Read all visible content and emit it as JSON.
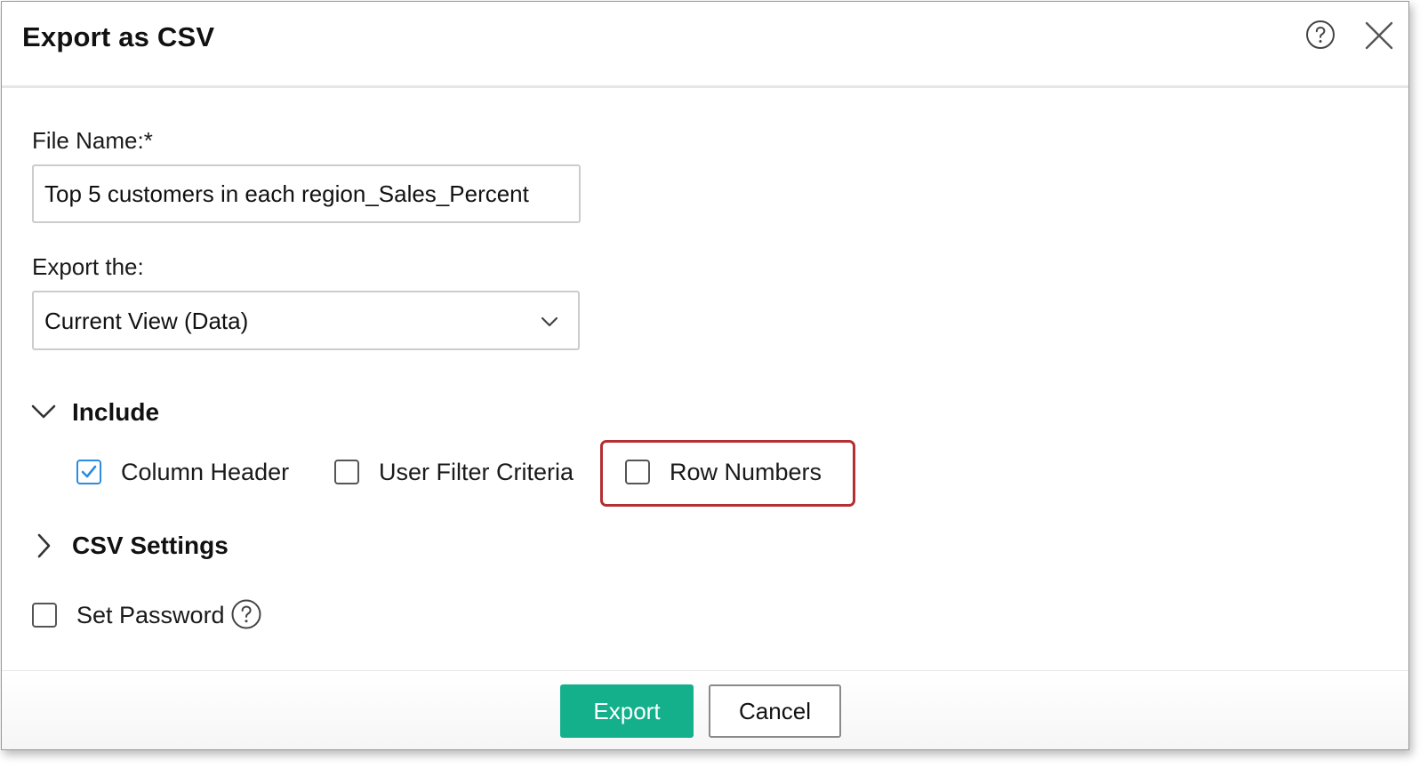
{
  "dialog": {
    "title": "Export as CSV"
  },
  "icons": {
    "help": "help-icon",
    "close": "close-icon",
    "chevron_down": "chevron-down-icon",
    "chevron_right": "chevron-right-icon",
    "checkmark": "checkmark-icon"
  },
  "form": {
    "file_name_label": "File Name:*",
    "file_name_value": "Top 5 customers in each region_Sales_Percent",
    "export_label": "Export the:",
    "export_value": "Current View (Data)"
  },
  "include": {
    "label": "Include",
    "expanded": true,
    "options": [
      {
        "label": "Column Header",
        "checked": true
      },
      {
        "label": "User Filter Criteria",
        "checked": false
      },
      {
        "label": "Row Numbers",
        "checked": false
      }
    ]
  },
  "csv_settings": {
    "label": "CSV Settings",
    "expanded": false
  },
  "password": {
    "label": "Set Password",
    "checked": false
  },
  "footer": {
    "export_label": "Export",
    "cancel_label": "Cancel"
  },
  "colors": {
    "primary": "#14b08c",
    "checkbox_checked": "#2b8ce0",
    "highlight": "#b42e32"
  }
}
